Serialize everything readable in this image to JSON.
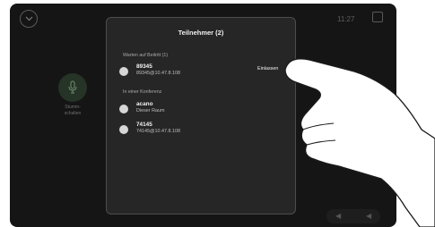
{
  "status_bar": {
    "time": "11:27"
  },
  "background": {
    "mic_label": "Stumm-\nschalten",
    "mic_label_line1": "Stumm-",
    "mic_label_line2": "schalten"
  },
  "participants_panel": {
    "title": "Teilnehmer (2)",
    "waiting_section": "Warten auf Beitritt (1)",
    "waiting": [
      {
        "name": "89345",
        "address": "89345@10.47.8.108",
        "action": "Einlassen"
      }
    ],
    "conference_section": "In einer Konferenz",
    "in_conference": [
      {
        "name": "acano",
        "address": "Dieser Raum"
      },
      {
        "name": "74145",
        "address": "74145@10.47.8.108"
      }
    ]
  }
}
